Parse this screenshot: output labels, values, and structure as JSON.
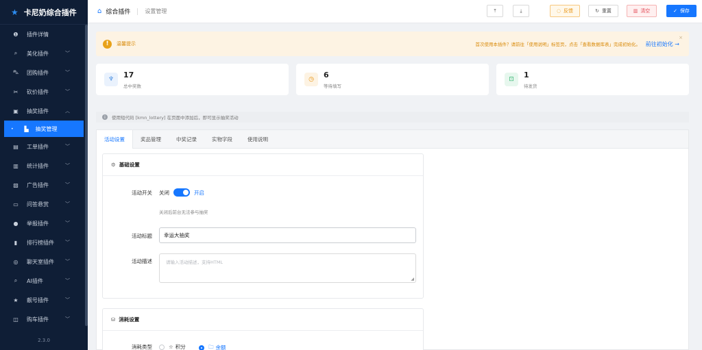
{
  "app": {
    "title": "卡尼奶综合插件",
    "version": "2.3.0"
  },
  "sidebar": {
    "items": [
      {
        "icon": "info-icon",
        "glyph": "❶",
        "label": "插件详情",
        "has_chevron": false
      },
      {
        "icon": "brush-icon",
        "glyph": "⌕",
        "label": "美化插件",
        "has_chevron": true
      },
      {
        "icon": "cart-icon",
        "glyph": "⛍",
        "label": "团购插件",
        "has_chevron": true
      },
      {
        "icon": "scissors-icon",
        "glyph": "✂",
        "label": "砍价插件",
        "has_chevron": true
      },
      {
        "icon": "gift-icon",
        "glyph": "▣",
        "label": "抽奖插件",
        "has_chevron": true,
        "expanded": true
      }
    ],
    "sub_item": {
      "label": "抽奖管理"
    },
    "items_after": [
      {
        "icon": "ticket-icon",
        "glyph": "▤",
        "label": "工单插件"
      },
      {
        "icon": "stats-icon",
        "glyph": "▥",
        "label": "统计插件"
      },
      {
        "icon": "ad-icon",
        "glyph": "▧",
        "label": "广告插件"
      },
      {
        "icon": "chat-icon",
        "glyph": "▭",
        "label": "问答悬赏"
      },
      {
        "icon": "report-icon",
        "glyph": "●",
        "label": "举报插件"
      },
      {
        "icon": "rank-icon",
        "glyph": "▮",
        "label": "排行榜插件"
      },
      {
        "icon": "chatroom-icon",
        "glyph": "◎",
        "label": "聊天室插件"
      },
      {
        "icon": "ai-icon",
        "glyph": "⌕",
        "label": "AI插件"
      },
      {
        "icon": "star-icon",
        "glyph": "★",
        "label": "靓号插件"
      },
      {
        "icon": "car-icon",
        "glyph": "◫",
        "label": "购车插件"
      }
    ]
  },
  "header": {
    "title": "综合插件",
    "subtitle": "设置管理",
    "buttons": {
      "feedback": "反馈",
      "reset": "重置",
      "clear": "清空",
      "save": "保存"
    }
  },
  "notice": {
    "title": "温馨提示",
    "message": "首次使用本插件？请前往「使用说明」标签页，点击「查看数据库表」完成初始化。",
    "link": "前往初始化 →"
  },
  "stats": [
    {
      "icon": "trophy-icon",
      "glyph": "♆",
      "value": "17",
      "label": "总中奖数",
      "color": "#4a90e2",
      "bg": "#eaf2fd"
    },
    {
      "icon": "clock-icon",
      "glyph": "◷",
      "value": "6",
      "label": "等待填写",
      "color": "#e8910c",
      "bg": "#fdf3e3"
    },
    {
      "icon": "gift-box-icon",
      "glyph": "⊡",
      "value": "1",
      "label": "待发货",
      "color": "#2db36b",
      "bg": "#e7f7ee"
    }
  ],
  "tip": {
    "text": "使用短代码 [kmn_lottery] 在页面中添加后，即可显示抽奖活动"
  },
  "tabs": [
    "活动设置",
    "奖品管理",
    "中奖记录",
    "实物字段",
    "使用说明"
  ],
  "basic": {
    "title": "基础设置",
    "switch_label": "活动开关",
    "off_text": "关闭",
    "on_text": "开启",
    "switch_hint": "关闭后前台无法参与抽奖",
    "title_label": "活动标题",
    "title_value": "幸运大抽奖",
    "desc_label": "活动描述",
    "desc_placeholder": "请输入活动描述，支持HTML"
  },
  "cost": {
    "title": "消耗设置",
    "type_label": "消耗类型",
    "options": [
      "积分",
      "余额"
    ],
    "selected": "余额"
  },
  "colors": {
    "accent": "#1677ff",
    "sidebar": "#0f1e36"
  }
}
